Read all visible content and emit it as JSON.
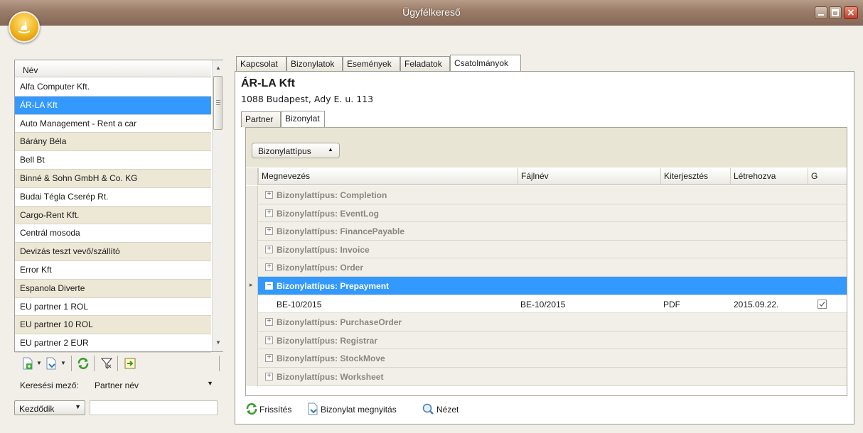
{
  "window": {
    "title": "Ügyfélkereső"
  },
  "customer_list": {
    "header": "Név",
    "items": [
      "Alfa Computer Kft.",
      "ÁR-LA Kft",
      "Auto Management - Rent a car",
      "Bárány Béla",
      "Bell Bt",
      "Binné & Sohn GmbH & Co. KG",
      "Budai Tégla Cserép Rt.",
      "Cargo-Rent Kft.",
      "Centrál mosoda",
      "Devizás teszt vevő/szállító",
      "Error Kft",
      "Espanola Diverte",
      "EU partner 1 ROL",
      "EU partner 10 ROL",
      "EU partner 2 EUR"
    ],
    "selected": "ÁR-LA Kft"
  },
  "search": {
    "field_label": "Keresési mező:",
    "field_value": "Partner név",
    "mode_value": "Kezdődik",
    "text_value": ""
  },
  "tabs": [
    "Kapcsolat",
    "Bizonylatok",
    "Események",
    "Feladatok",
    "Csatolmányok"
  ],
  "active_tab": "Csatolmányok",
  "company": {
    "name": "ÁR-LA Kft",
    "address": "1088 Budapest, Ady E. u. 113"
  },
  "sub_tabs": [
    "Partner",
    "Bizonylat"
  ],
  "active_sub_tab": "Bizonylat",
  "grid": {
    "group_chip": "Bizonylattípus",
    "columns": [
      "Megnevezés",
      "Fájlnév",
      "Kiterjesztés",
      "Létrehozva",
      "G"
    ],
    "groups": [
      "Bizonylattípus: Completion",
      "Bizonylattípus: EventLog",
      "Bizonylattípus: FinancePayable",
      "Bizonylattípus: Invoice",
      "Bizonylattípus: Order",
      "Bizonylattípus: Prepayment",
      "Bizonylattípus: PurchaseOrder",
      "Bizonylattípus: Registrar",
      "Bizonylattípus: StockMove",
      "Bizonylattípus: Worksheet"
    ],
    "expanded_group": "Bizonylattípus: Prepayment",
    "expanded_row": {
      "name": "BE-10/2015",
      "file": "BE-10/2015",
      "ext": "PDF",
      "created": "2015.09.22.",
      "checked": true
    }
  },
  "bottom_actions": {
    "refresh": "Frissítés",
    "open": "Bizonylat megnyitás",
    "view": "Nézet"
  },
  "colors": {
    "selection": "#3399ff",
    "title_bar": "#9a7c68",
    "alt_row": "#ede8d6"
  }
}
